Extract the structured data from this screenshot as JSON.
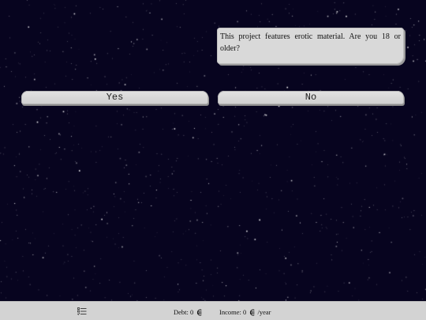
{
  "dialog": {
    "text": "This project features erotic material. Are you 18 or older?"
  },
  "choices": {
    "yes_label": "Yes",
    "no_label": "No"
  },
  "status_bar": {
    "menu_icon": "checklist-icon",
    "debt_label": "Debt: 0",
    "income_label": "Income: 0",
    "income_suffix": "/year",
    "currency_icon": "credit-currency-icon"
  },
  "colors": {
    "background": "#07041f",
    "panel": "#d9d9d9",
    "status_bar": "#d3d3d3"
  }
}
